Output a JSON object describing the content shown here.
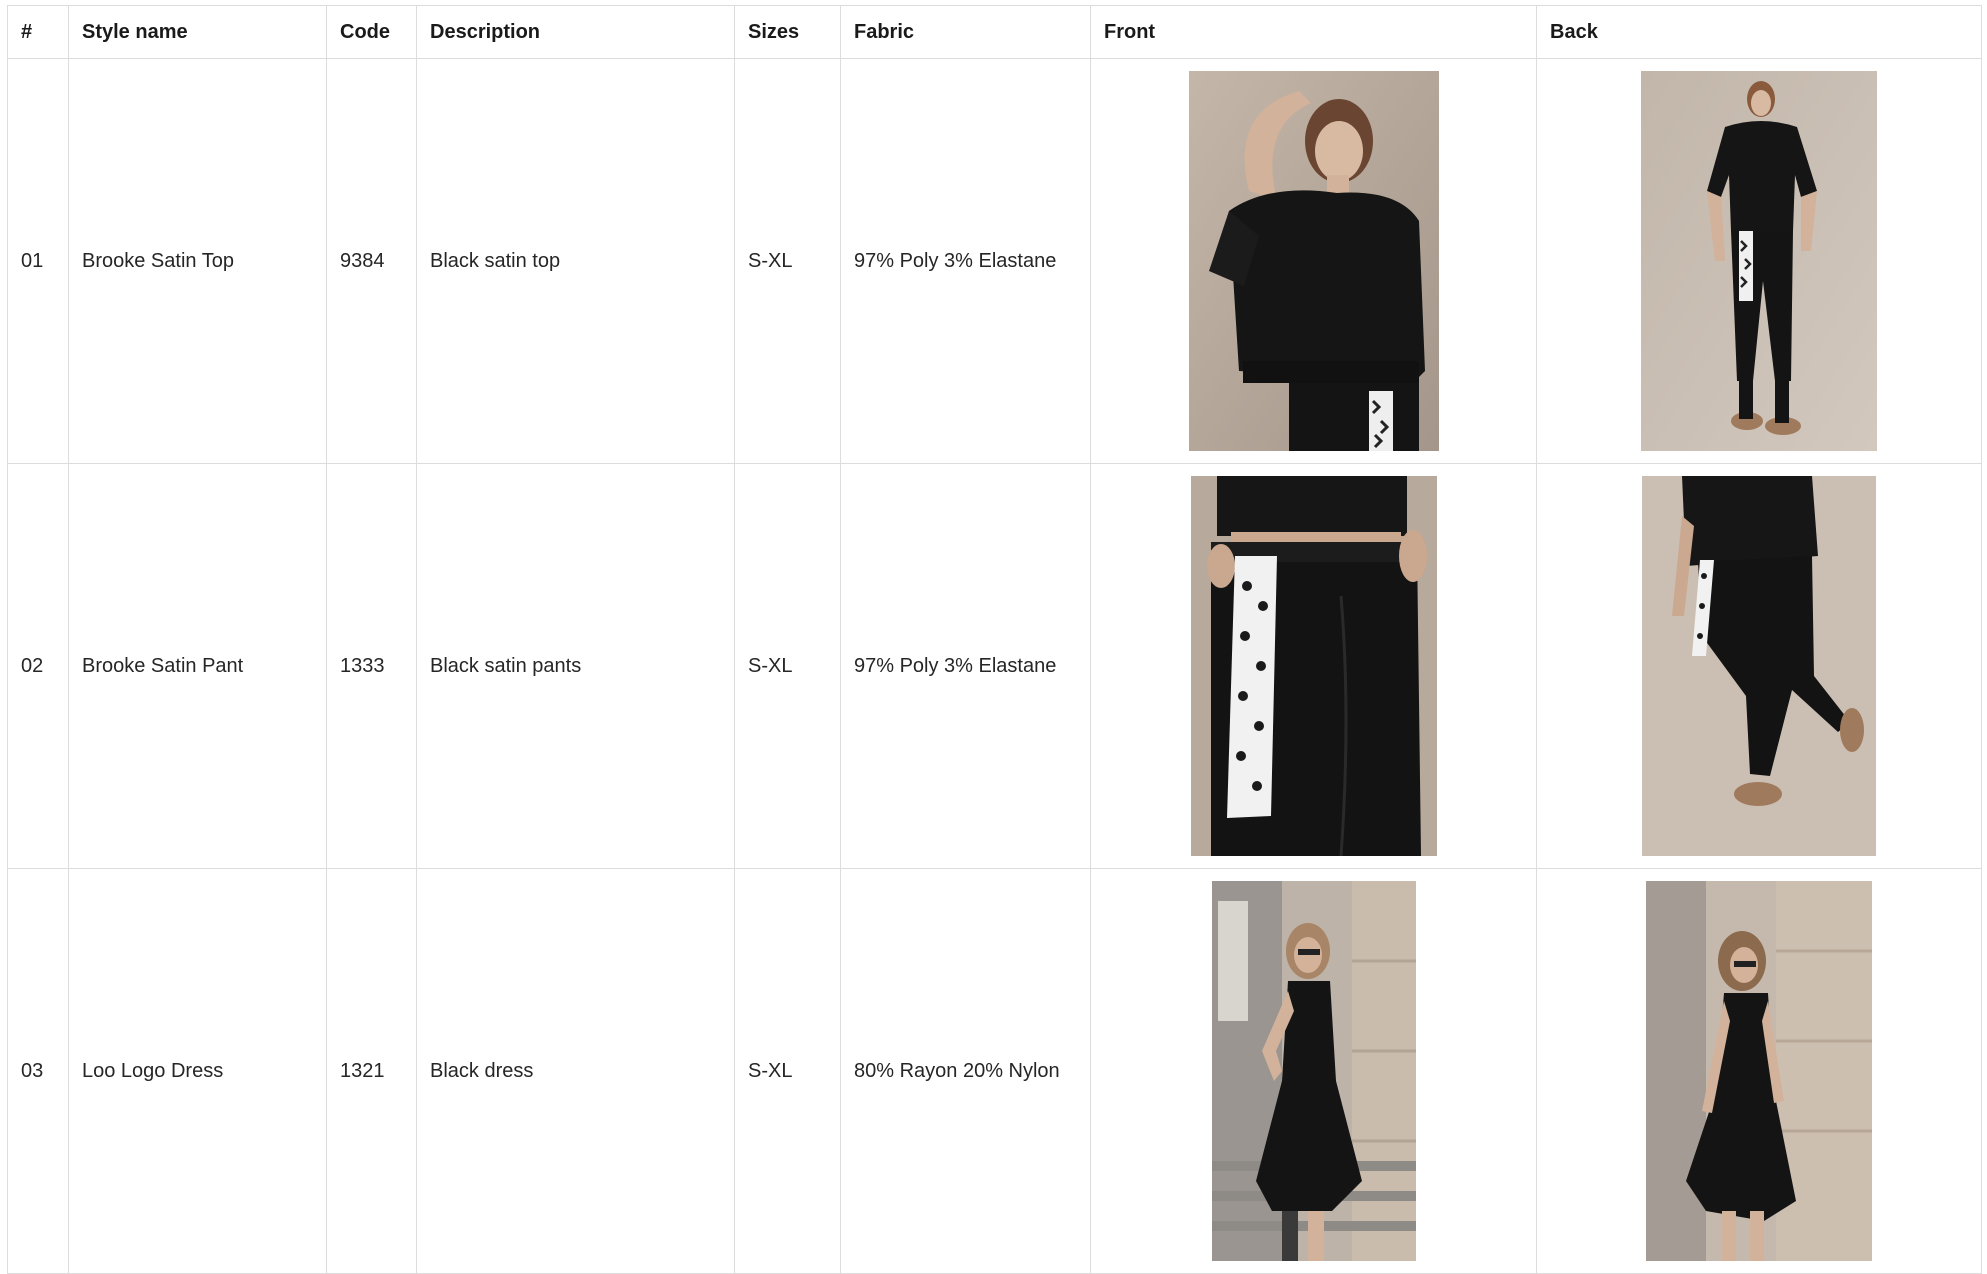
{
  "table": {
    "headers": [
      "#",
      "Style name",
      "Code",
      "Description",
      "Sizes",
      "Fabric",
      "Front",
      "Back"
    ],
    "rows": [
      {
        "num": "01",
        "style": "Brooke Satin Top",
        "code": "9384",
        "description": "Black satin top",
        "sizes": "S-XL",
        "fabric": "97% Poly 3% Elastane",
        "front_image": "model-black-satin-top-front-photo",
        "back_image": "model-black-satin-top-full-length-photo"
      },
      {
        "num": "02",
        "style": "Brooke Satin Pant",
        "code": "1333",
        "description": "Black satin pants",
        "sizes": "S-XL",
        "fabric": "97% Poly 3% Elastane",
        "front_image": "black-satin-pants-waist-closeup-photo",
        "back_image": "black-satin-pants-walking-photo"
      },
      {
        "num": "03",
        "style": "Loo Logo Dress",
        "code": "1321",
        "description": "Black dress",
        "sizes": "S-XL",
        "fabric": "80% Rayon 20% Nylon",
        "front_image": "black-dress-on-steps-photo",
        "back_image": "black-dress-walking-street-photo"
      }
    ]
  },
  "colors": {
    "grid_line": "#dcdcdc",
    "studio_backdrop": "#b8aa9c",
    "street_backdrop": "#bdb2a6",
    "garment": "#151515"
  }
}
